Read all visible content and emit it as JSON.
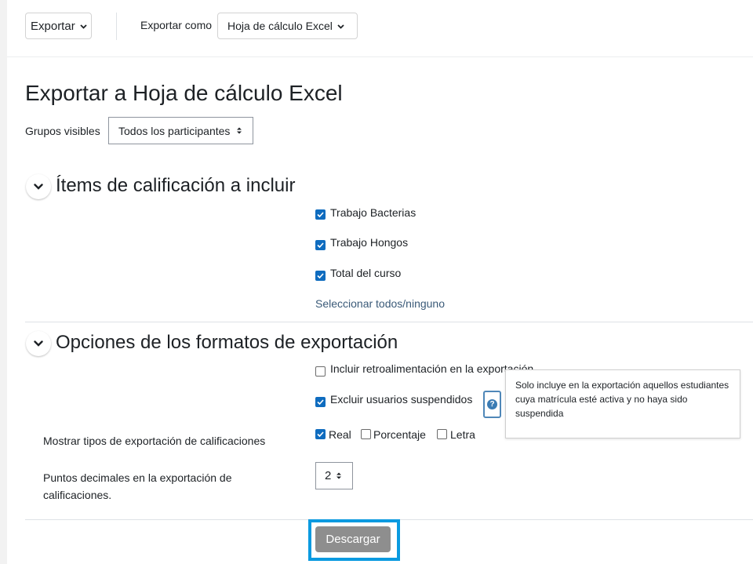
{
  "toolbar": {
    "export_label": "Exportar",
    "export_as_label": "Exportar como",
    "export_as_value": "Hoja de cálculo Excel"
  },
  "page_title": "Exportar a Hoja de cálculo Excel",
  "groups": {
    "label": "Grupos visibles",
    "value": "Todos los participantes"
  },
  "section_items": {
    "title": "Ítems de calificación a incluir",
    "items": [
      {
        "label": "Trabajo Bacterias",
        "checked": true
      },
      {
        "label": "Trabajo Hongos",
        "checked": true
      },
      {
        "label": "Total del curso",
        "checked": true
      }
    ],
    "select_all": "Seleccionar todos/ninguno"
  },
  "section_options": {
    "title": "Opciones de los formatos de exportación",
    "include_feedback": "Incluir retroalimentación en la exportación",
    "exclude_suspended": "Excluir usuarios suspendidos",
    "tooltip": "Solo incluye en la exportación aquellos estudiantes cuya matrícula esté activa y no haya sido suspendida",
    "display_types_label": "Mostrar tipos de exportación de calificaciones",
    "display_types": [
      {
        "label": "Real",
        "checked": true
      },
      {
        "label": "Porcentaje",
        "checked": false
      },
      {
        "label": "Letra",
        "checked": false
      }
    ],
    "decimals_label": "Puntos decimales en la exportación de calificaciones.",
    "decimals_value": "2"
  },
  "download_label": "Descargar",
  "colors": {
    "accent": "#0f6cbf",
    "highlight": "#0a9ae0",
    "button_disabled": "#8e8e8e"
  }
}
